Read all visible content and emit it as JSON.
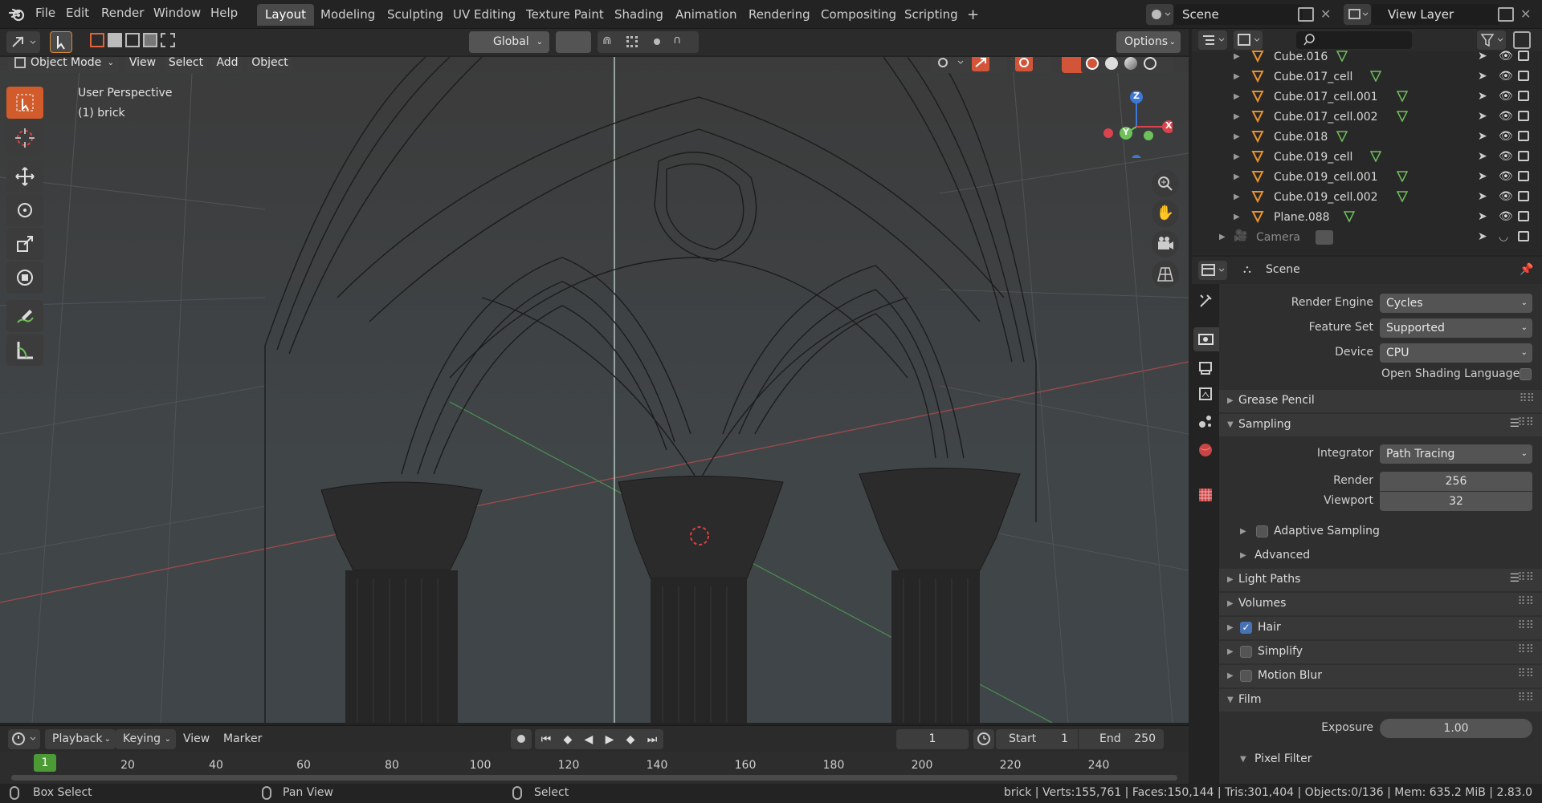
{
  "topbar": {
    "menu": [
      "File",
      "Edit",
      "Render",
      "Window",
      "Help"
    ],
    "workspaces": [
      "Layout",
      "Modeling",
      "Sculpting",
      "UV Editing",
      "Texture Paint",
      "Shading",
      "Animation",
      "Rendering",
      "Compositing",
      "Scripting"
    ],
    "active_workspace": "Layout",
    "add_workspace": "+",
    "scene": "Scene",
    "view_layer": "View Layer"
  },
  "viewport_header": {
    "transform_orientation": "Global",
    "options": "Options",
    "mode": "Object Mode",
    "menus": [
      "View",
      "Select",
      "Add",
      "Object"
    ]
  },
  "viewport": {
    "perspective": "User Perspective",
    "active_object": "(1) brick",
    "gizmo": {
      "z": "Z",
      "y": "Y",
      "x": "X"
    },
    "colors": {
      "x_axis": "#d9434e",
      "y_axis": "#6ec15a",
      "z_axis": "#3e78d6",
      "axis_line_x": "#a04a4a",
      "axis_line_y": "#4a8a52"
    }
  },
  "toolbar": {
    "tools": [
      "select-box-icon",
      "cursor-icon",
      "move-icon",
      "rotate-icon",
      "scale-icon",
      "transform-icon",
      "annotate-icon",
      "measure-icon"
    ]
  },
  "timeline": {
    "menus": [
      "Playback",
      "Keying",
      "View",
      "Marker"
    ],
    "current_frame": "1",
    "start_label": "Start",
    "start": "1",
    "end_label": "End",
    "end": "250",
    "ticks": [
      "20",
      "40",
      "60",
      "80",
      "100",
      "120",
      "140",
      "160",
      "180",
      "200",
      "220",
      "240"
    ],
    "frame_marker": "1"
  },
  "statusbar": {
    "left_action": "Box Select",
    "middle_action": "Pan View",
    "right_action": "Select",
    "stats": "brick | Verts:155,761 | Faces:150,144 | Tris:301,404 | Objects:0/136 | Mem: 635.2 MiB | 2.83.0"
  },
  "outliner": {
    "rows": [
      "Cube.016",
      "Cube.017_cell",
      "Cube.017_cell.001",
      "Cube.017_cell.002",
      "Cube.018",
      "Cube.019_cell",
      "Cube.019_cell.001",
      "Cube.019_cell.002",
      "Plane.088"
    ],
    "camera": "Camera"
  },
  "properties": {
    "context": "Scene",
    "render_engine_label": "Render Engine",
    "render_engine": "Cycles",
    "feature_set_label": "Feature Set",
    "feature_set": "Supported",
    "device_label": "Device",
    "device": "CPU",
    "osl_label": "Open Shading Language",
    "grease_pencil": "Grease Pencil",
    "sampling": "Sampling",
    "integrator_label": "Integrator",
    "integrator": "Path Tracing",
    "render_label": "Render",
    "render_samples": "256",
    "viewport_label": "Viewport",
    "viewport_samples": "32",
    "adaptive_sampling": "Adaptive Sampling",
    "advanced": "Advanced",
    "light_paths": "Light Paths",
    "volumes": "Volumes",
    "hair": "Hair",
    "simplify": "Simplify",
    "motion_blur": "Motion Blur",
    "film": "Film",
    "exposure_label": "Exposure",
    "exposure": "1.00",
    "pixel_filter": "Pixel Filter"
  }
}
